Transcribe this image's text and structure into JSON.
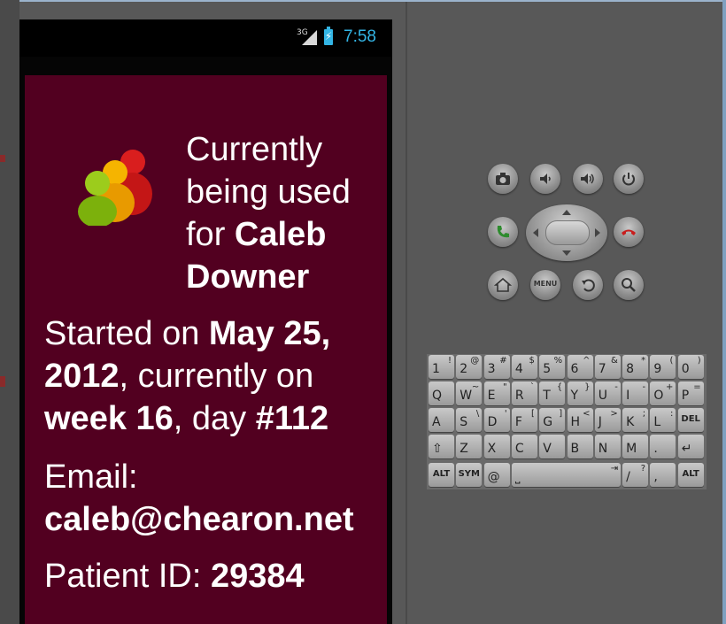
{
  "status": {
    "network": "3G",
    "time": "7:58",
    "battery_icon": "battery-charging-icon",
    "signal_icon": "signal-icon"
  },
  "colors": {
    "screen_bg": "#520020",
    "status_accent": "#33b5e5",
    "text": "#ffffff"
  },
  "app": {
    "logo_icon": "people-group-icon",
    "header_prefix": "Currently being used for",
    "user_name": "Caleb Downer",
    "started_prefix": "Started on",
    "start_date": "May 25, 2012",
    "currently_on": ", currently on",
    "week": "week 16",
    "day_sep": ", day",
    "day": "#112",
    "email_label": "Email:",
    "email": "caleb@chearon.net",
    "patient_label": "Patient ID:",
    "patient_id": "29384"
  },
  "keyboard": {
    "row1": [
      [
        "1",
        "!"
      ],
      [
        "2",
        "@"
      ],
      [
        "3",
        "#"
      ],
      [
        "4",
        "$"
      ],
      [
        "5",
        "%"
      ],
      [
        "6",
        "^"
      ],
      [
        "7",
        "&"
      ],
      [
        "8",
        "*"
      ],
      [
        "9",
        "("
      ],
      [
        "0",
        ")"
      ]
    ],
    "row2": [
      [
        "Q",
        ""
      ],
      [
        "W",
        "~"
      ],
      [
        "E",
        "\""
      ],
      [
        "R",
        "`"
      ],
      [
        "T",
        "{"
      ],
      [
        "Y",
        "}"
      ],
      [
        "U",
        "-"
      ],
      [
        "I",
        "-"
      ],
      [
        "O",
        "+"
      ],
      [
        "P",
        "="
      ]
    ],
    "row3": [
      [
        "A",
        ""
      ],
      [
        "S",
        "\\"
      ],
      [
        "D",
        "'"
      ],
      [
        "F",
        "["
      ],
      [
        "G",
        "]"
      ],
      [
        "H",
        "<"
      ],
      [
        "J",
        ">"
      ],
      [
        "K",
        ";"
      ],
      [
        "L",
        ":"
      ]
    ],
    "row4": [
      [
        "Z",
        ""
      ],
      [
        "X",
        ""
      ],
      [
        "C",
        ""
      ],
      [
        "V",
        ""
      ],
      [
        "B",
        ""
      ],
      [
        "N",
        ""
      ],
      [
        "M",
        ""
      ],
      [
        ".",
        ""
      ]
    ],
    "row5_labels": {
      "alt": "ALT",
      "sym": "SYM",
      "at": "@",
      "slash": "/",
      "question": "?",
      "comma": ",",
      "del": "DEL"
    }
  }
}
